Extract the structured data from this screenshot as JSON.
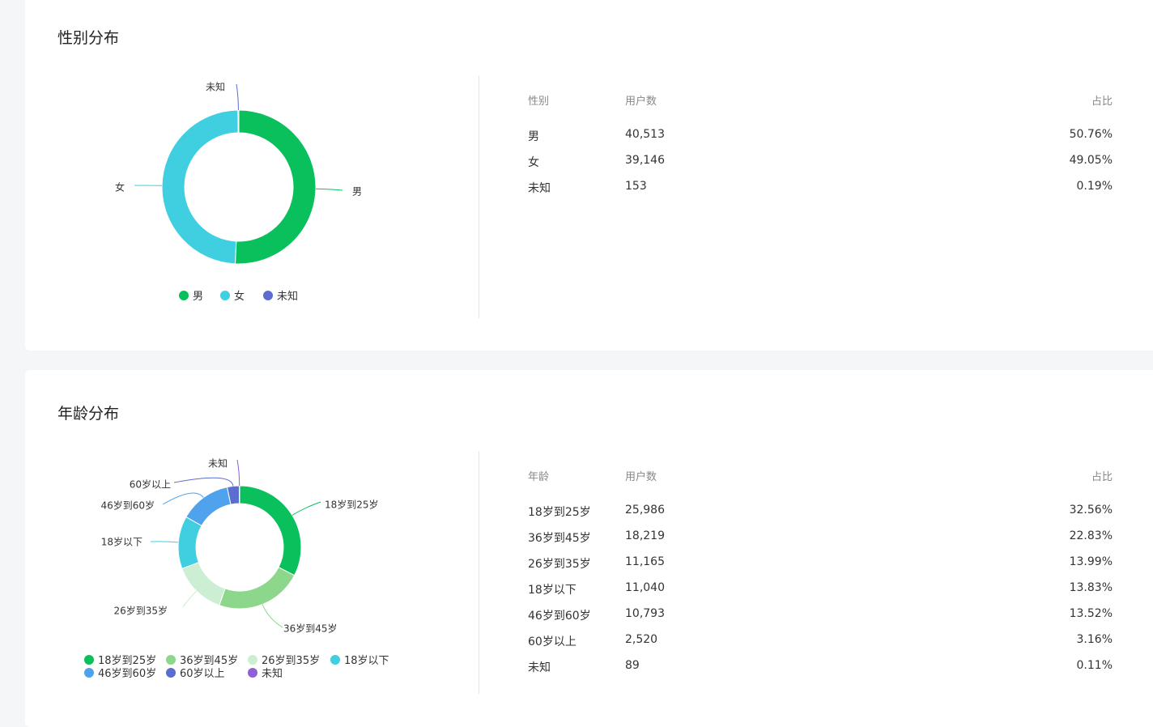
{
  "gender": {
    "title": "性别分布",
    "table": {
      "headers": [
        "性别",
        "用户数",
        "占比"
      ],
      "rows": [
        {
          "label": "男",
          "count": "40,513",
          "pct": "50.76%"
        },
        {
          "label": "女",
          "count": "39,146",
          "pct": "49.05%"
        },
        {
          "label": "未知",
          "count": "153",
          "pct": "0.19%"
        }
      ]
    },
    "chart_data": {
      "type": "pie",
      "categories": [
        "男",
        "女",
        "未知"
      ],
      "values": [
        40513,
        39146,
        153
      ],
      "colors": [
        "#09c05c",
        "#40cee1",
        "#5b6ed0"
      ],
      "legend": "bottom"
    }
  },
  "age": {
    "title": "年龄分布",
    "table": {
      "headers": [
        "年龄",
        "用户数",
        "占比"
      ],
      "rows": [
        {
          "label": "18岁到25岁",
          "count": "25,986",
          "pct": "32.56%"
        },
        {
          "label": "36岁到45岁",
          "count": "18,219",
          "pct": "22.83%"
        },
        {
          "label": "26岁到35岁",
          "count": "11,165",
          "pct": "13.99%"
        },
        {
          "label": "18岁以下",
          "count": "11,040",
          "pct": "13.83%"
        },
        {
          "label": "46岁到60岁",
          "count": "10,793",
          "pct": "13.52%"
        },
        {
          "label": "60岁以上",
          "count": "2,520",
          "pct": "3.16%"
        },
        {
          "label": "未知",
          "count": "89",
          "pct": "0.11%"
        }
      ]
    },
    "chart_data": {
      "type": "pie",
      "categories": [
        "18岁到25岁",
        "36岁到45岁",
        "26岁到35岁",
        "18岁以下",
        "46岁到60岁",
        "60岁以上",
        "未知"
      ],
      "values": [
        25986,
        18219,
        11165,
        11040,
        10793,
        2520,
        89
      ],
      "colors": [
        "#09c05c",
        "#8cd78b",
        "#ccefd3",
        "#40cee1",
        "#4fa3ec",
        "#5b6ed0",
        "#8f5fd6"
      ],
      "legend": "bottom"
    }
  }
}
